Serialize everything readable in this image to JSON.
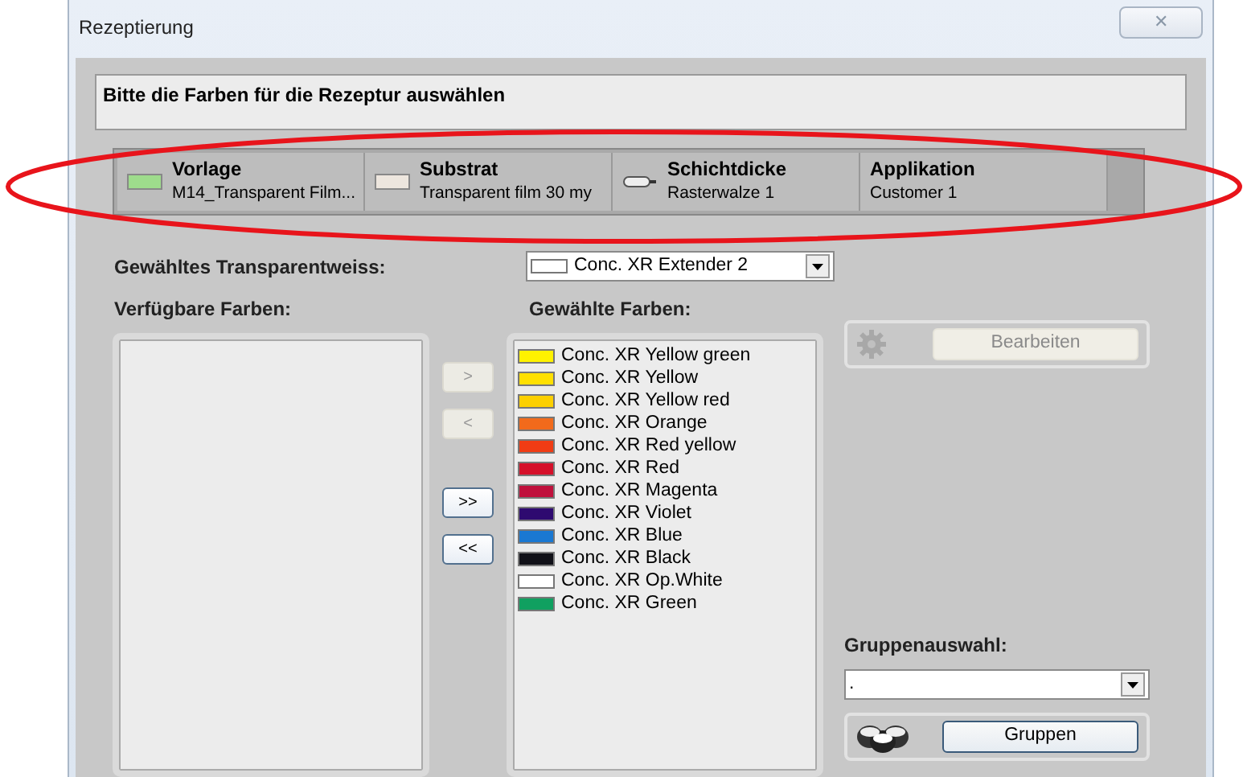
{
  "window": {
    "title": "Rezeptierung",
    "close": "✕"
  },
  "instruction": "Bitte die Farben für die Rezeptur auswählen",
  "info_bar": [
    {
      "kind": "swatch",
      "color": "#9edc8c",
      "title": "Vorlage",
      "value": "M14_Transparent Film..."
    },
    {
      "kind": "swatch",
      "color": "#ede6de",
      "title": "Substrat",
      "value": "Transparent film 30 my"
    },
    {
      "kind": "roller",
      "title": "Schichtdicke",
      "value": "Rasterwalze 1"
    },
    {
      "kind": "none",
      "title": "Applikation",
      "value": "Customer 1"
    }
  ],
  "transparent_white": {
    "label": "Gewähltes Transparentweiss:",
    "value": "Conc. XR Extender 2",
    "color": "#ffffff"
  },
  "available": {
    "label": "Verfügbare Farben:"
  },
  "selected_colors": {
    "label": "Gewählte Farben:",
    "items": [
      {
        "name": "Conc. XR Yellow green",
        "color": "#fff200"
      },
      {
        "name": "Conc. XR Yellow",
        "color": "#ffe000"
      },
      {
        "name": "Conc. XR Yellow red",
        "color": "#fcd000"
      },
      {
        "name": "Conc. XR Orange",
        "color": "#f26a1b"
      },
      {
        "name": "Conc. XR Red yellow",
        "color": "#f03c14"
      },
      {
        "name": "Conc. XR Red",
        "color": "#d5102a"
      },
      {
        "name": "Conc. XR Magenta",
        "color": "#c0103c"
      },
      {
        "name": "Conc. XR Violet",
        "color": "#2e0a70"
      },
      {
        "name": "Conc. XR Blue",
        "color": "#1a78d2"
      },
      {
        "name": "Conc. XR Black",
        "color": "#111118"
      },
      {
        "name": "Conc. XR Op.White",
        "color": "#ffffff"
      },
      {
        "name": "Conc. XR Green",
        "color": "#10a060"
      }
    ]
  },
  "transfer_buttons": [
    {
      "label": ">",
      "disabled": true
    },
    {
      "label": "<",
      "disabled": true
    },
    {
      "label": ">>",
      "disabled": false
    },
    {
      "label": "<<",
      "disabled": false
    }
  ],
  "edit_button": {
    "label": "Bearbeiten",
    "disabled": true
  },
  "group_select": {
    "label": "Gruppenauswahl:",
    "value": "."
  },
  "groups_button": {
    "label": "Gruppen",
    "disabled": false
  }
}
